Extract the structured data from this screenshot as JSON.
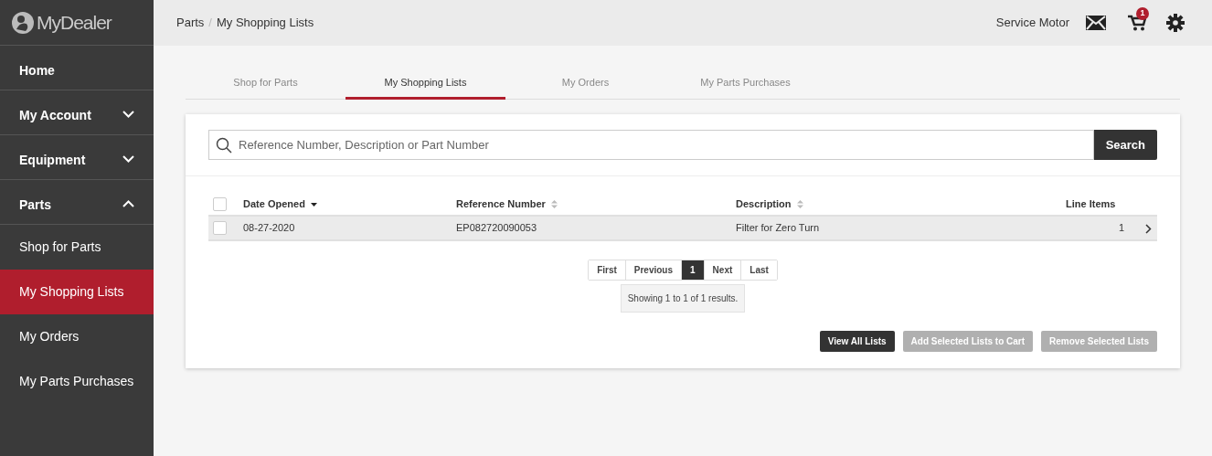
{
  "brand": "MyDealer",
  "sidebar": {
    "items": [
      {
        "label": "Home",
        "kind": "section",
        "selected": false
      },
      {
        "label": "My Account",
        "kind": "section",
        "expanded": false,
        "selected": false
      },
      {
        "label": "Equipment",
        "kind": "section",
        "expanded": false,
        "selected": false
      },
      {
        "label": "Parts",
        "kind": "section",
        "expanded": true,
        "selected": false
      },
      {
        "label": "Shop for Parts",
        "kind": "sub",
        "selected": false
      },
      {
        "label": "My Shopping Lists",
        "kind": "sub",
        "selected": true
      },
      {
        "label": "My Orders",
        "kind": "sub",
        "selected": false
      },
      {
        "label": "My Parts Purchases",
        "kind": "sub",
        "selected": false
      }
    ]
  },
  "breadcrumb": [
    "Parts",
    "My Shopping Lists"
  ],
  "breadcrumb_separator": "/",
  "topbar": {
    "user": "Service Motor",
    "cart_count": "1"
  },
  "tabs": [
    {
      "label": "Shop for Parts",
      "selected": false
    },
    {
      "label": "My Shopping Lists",
      "selected": true
    },
    {
      "label": "My Orders",
      "selected": false
    },
    {
      "label": "My Parts Purchases",
      "selected": false
    }
  ],
  "search": {
    "placeholder": "Reference Number, Description or Part Number",
    "button": "Search"
  },
  "table": {
    "select_all_checked": false,
    "columns": [
      {
        "label": "Date Opened",
        "sortable": true,
        "sorted": true
      },
      {
        "label": "Reference Number",
        "sortable": true,
        "sorted": false
      },
      {
        "label": "Description",
        "sortable": true,
        "sorted": false
      },
      {
        "label": "Line Items",
        "sortable": false
      }
    ],
    "rows": [
      {
        "checked": false,
        "cells": [
          "08-27-2020",
          "EP082720090053",
          "Filter for Zero Turn",
          "1"
        ]
      }
    ]
  },
  "pagination": {
    "pages": [
      {
        "label": "First",
        "selected": false
      },
      {
        "label": "Previous",
        "selected": false
      },
      {
        "label": "1",
        "selected": true
      },
      {
        "label": "Next",
        "selected": false
      },
      {
        "label": "Last",
        "selected": false
      }
    ],
    "summary": "Showing 1 to 1 of 1 results."
  },
  "actions": [
    {
      "label": "View All Lists",
      "disabled": false
    },
    {
      "label": "Add Selected Lists to Cart",
      "disabled": true
    },
    {
      "label": "Remove Selected Lists",
      "disabled": true
    }
  ]
}
